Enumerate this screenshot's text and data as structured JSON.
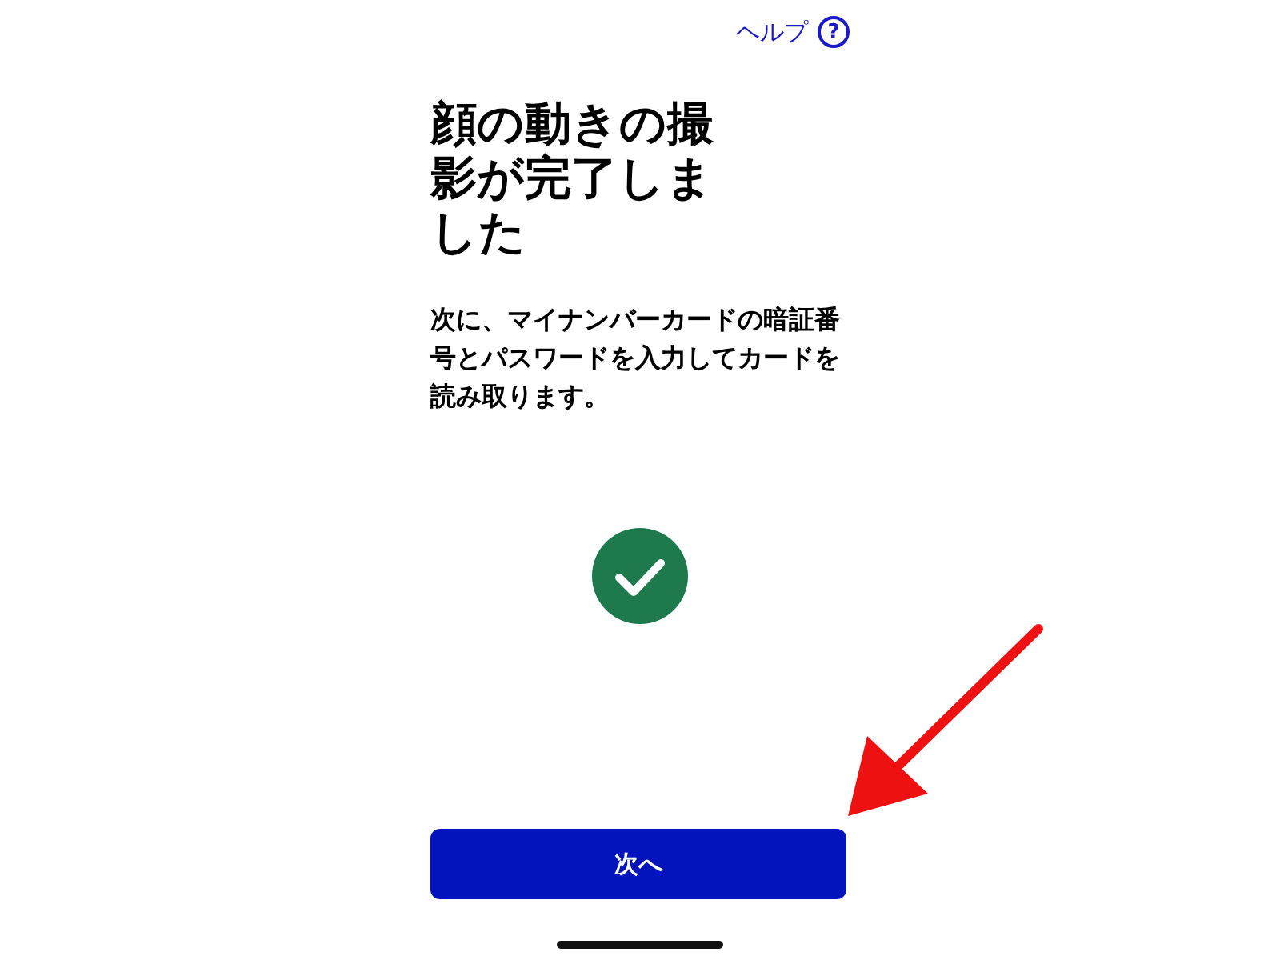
{
  "help_link": {
    "label": "ヘルプ",
    "icon": "?"
  },
  "title": "顔の動きの撮影が完了しました",
  "description": "次に、マイナンバーカードの暗証番号とパスワードを入力してカードを読み取ります。",
  "status": {
    "kind": "success"
  },
  "next_button": {
    "label": "次へ"
  }
}
